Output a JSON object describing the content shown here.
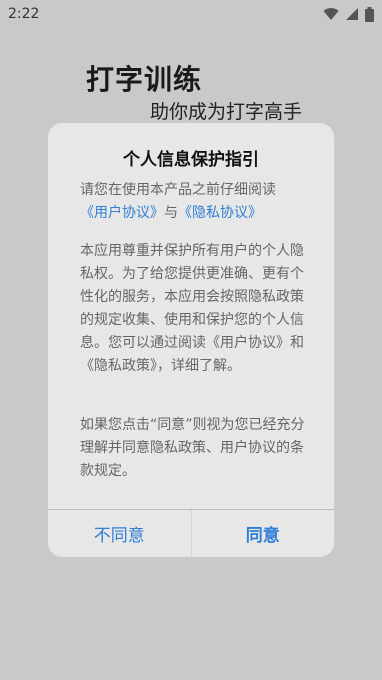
{
  "status_bar": {
    "time": "2:22",
    "icons": [
      "wifi-icon",
      "cell-signal-icon",
      "battery-icon"
    ]
  },
  "app": {
    "title": "打字训练",
    "subtitle": "助你成为打字高手"
  },
  "dialog": {
    "title": "个人信息保护指引",
    "p1_prefix": "请您在使用本产品之前仔细阅读",
    "link_user_agreement": "《用户协议》",
    "p1_and": "与",
    "link_privacy_agreement": "《隐私协议》",
    "p2": "本应用尊重并保护所有用户的个人隐私权。为了给您提供更准确、更有个性化的服务，本应用会按照隐私政策的规定收集、使用和保护您的个人信息。您可以通过阅读《用户协议》和《隐私政策》，详细了解。",
    "p3": "如果您点击“同意”则视为您已经充分理解并同意隐私政策、用户协议的条款规定。",
    "disagree_label": "不同意",
    "agree_label": "同意"
  },
  "colors": {
    "background": "#c9c9c9",
    "dialog_bg": "#e7e7e7",
    "accent": "#2f7fd6"
  }
}
